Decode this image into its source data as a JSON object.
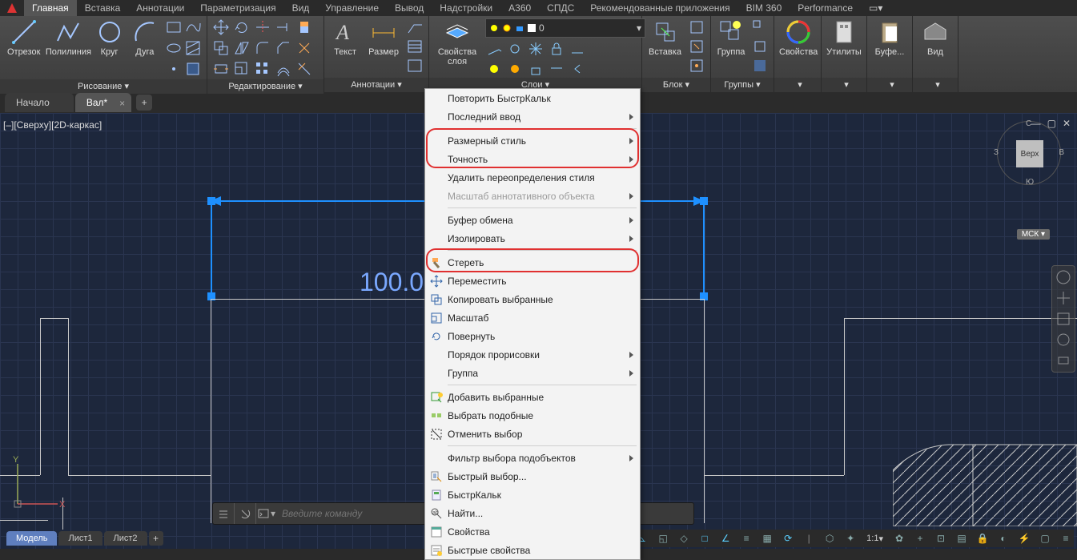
{
  "menubar": {
    "items": [
      "Главная",
      "Вставка",
      "Аннотации",
      "Параметризация",
      "Вид",
      "Управление",
      "Вывод",
      "Надстройки",
      "A360",
      "СПДС",
      "Рекомендованные приложения",
      "BIM 360",
      "Performance"
    ],
    "active": 0,
    "battery": "▭▾"
  },
  "ribbon": {
    "draw": {
      "title": "Рисование",
      "items": [
        "Отрезок",
        "Полилиния",
        "Круг",
        "Дуга"
      ]
    },
    "modify": {
      "title": "Редактирование"
    },
    "annot": {
      "title": "Аннотации",
      "items": [
        "Текст",
        "Размер"
      ]
    },
    "layers": {
      "title": "Слои",
      "btn1": "Свойства",
      "btn2": "слоя",
      "combo": "0"
    },
    "block": {
      "title": "Блок",
      "btn": "Вставка"
    },
    "group": {
      "title": "Группы",
      "btn": "Группа"
    },
    "props": {
      "title": "",
      "btn": "Свойства"
    },
    "utils": {
      "title": "",
      "btn": "Утилиты"
    },
    "clip": {
      "title": "",
      "btn": "Буфе..."
    },
    "view": {
      "title": "",
      "btn": "Вид"
    }
  },
  "doctabs": {
    "tabs": [
      {
        "label": "Начало"
      },
      {
        "label": "Вал*",
        "active": true
      }
    ]
  },
  "viewport": {
    "label": "[–][Сверху][2D-каркас]",
    "viewcube": {
      "face": "Верх",
      "n": "С",
      "s": "Ю",
      "e": "В",
      "w": "З"
    },
    "wcs": "МСК ▾"
  },
  "dimension": {
    "text": "100.0"
  },
  "cmdline": {
    "placeholder": "Введите команду"
  },
  "model_tabs": {
    "tabs": [
      "Модель",
      "Лист1",
      "Лист2"
    ],
    "active": 0
  },
  "status": {
    "scale": "1:1"
  },
  "context_menu": {
    "items": [
      {
        "label": "Повторить БыстрКальк"
      },
      {
        "label": "Последний ввод",
        "sub": true
      },
      {
        "sep": true
      },
      {
        "label": "Размерный стиль",
        "sub": true
      },
      {
        "label": "Точность",
        "sub": true
      },
      {
        "label": "Удалить переопределения стиля"
      },
      {
        "label": "Масштаб аннотативного объекта",
        "sub": true,
        "dis": true
      },
      {
        "sep": true
      },
      {
        "label": "Буфер обмена",
        "sub": true
      },
      {
        "label": "Изолировать",
        "sub": true
      },
      {
        "sep": true
      },
      {
        "label": "Стереть",
        "icon": "erase"
      },
      {
        "label": "Переместить",
        "icon": "move"
      },
      {
        "label": "Копировать выбранные",
        "icon": "copy"
      },
      {
        "label": "Масштаб",
        "icon": "scale"
      },
      {
        "label": "Повернуть",
        "icon": "rotate"
      },
      {
        "label": "Порядок прорисовки",
        "sub": true
      },
      {
        "label": "Группа",
        "sub": true
      },
      {
        "sep": true
      },
      {
        "label": "Добавить выбранные",
        "icon": "addsel"
      },
      {
        "label": "Выбрать подобные",
        "icon": "similar"
      },
      {
        "label": "Отменить выбор",
        "icon": "desel"
      },
      {
        "sep": true
      },
      {
        "label": "Фильтр выбора подобъектов",
        "sub": true
      },
      {
        "label": "Быстрый выбор...",
        "icon": "qsel"
      },
      {
        "label": "БыстрКальк",
        "icon": "calc"
      },
      {
        "label": "Найти...",
        "icon": "find"
      },
      {
        "label": "Свойства",
        "icon": "prop"
      },
      {
        "label": "Быстрые свойства",
        "icon": "qprop"
      }
    ]
  }
}
